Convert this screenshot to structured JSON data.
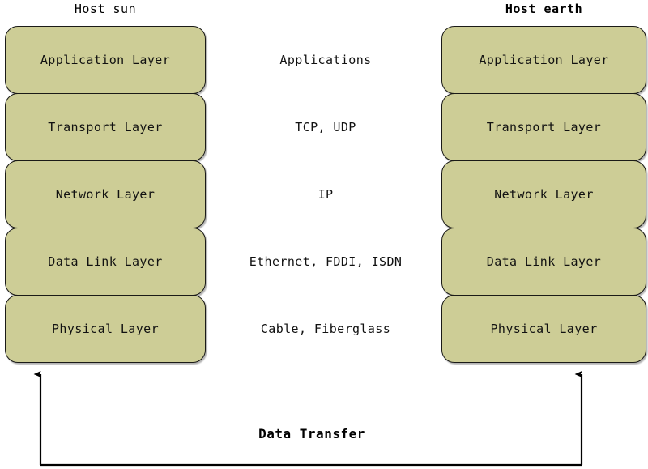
{
  "diagram": {
    "title_left": "Host sun",
    "title_right": "Host earth",
    "accent_fill": "#cdcd96",
    "border_color": "#1a1a17",
    "background": "#ffffff",
    "layers": [
      {
        "name": "Application Layer",
        "protocols": "Applications"
      },
      {
        "name": "Transport Layer",
        "protocols": "TCP, UDP"
      },
      {
        "name": "Network Layer",
        "protocols": "IP"
      },
      {
        "name": "Data Link Layer",
        "protocols": "Ethernet, FDDI, ISDN"
      },
      {
        "name": "Physical Layer",
        "protocols": "Cable, Fiberglass"
      }
    ],
    "transfer_label": "Data Transfer"
  }
}
